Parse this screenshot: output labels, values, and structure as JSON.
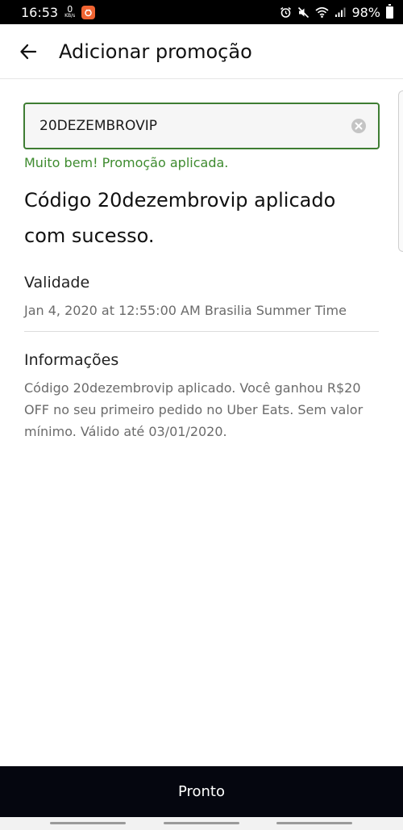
{
  "status_bar": {
    "time": "16:53",
    "kbs_value": "0",
    "kbs_unit": "KB/s",
    "battery": "98%"
  },
  "header": {
    "title": "Adicionar promoção",
    "back_icon": "arrow-left-icon"
  },
  "promo": {
    "code_value": "20DEZEMBROVIP",
    "clear_icon": "clear-circle-icon",
    "success_message": "Muito bem! Promoção aplicada.",
    "headline": "Código 20dezembrovip aplicado com sucesso."
  },
  "validity": {
    "label": "Validade",
    "value": "Jan 4, 2020 at 12:55:00 AM Brasilia Summer Time"
  },
  "info": {
    "label": "Informações",
    "value": "Código 20dezembrovip aplicado. Você ganhou R$20 OFF no seu primeiro pedido no Uber Eats. Sem valor mínimo. Válido até 03/01/2020."
  },
  "footer": {
    "done_label": "Pronto"
  },
  "colors": {
    "success": "#3e8b2f",
    "field_border": "#3e7d32",
    "button_bg": "#05060f"
  }
}
